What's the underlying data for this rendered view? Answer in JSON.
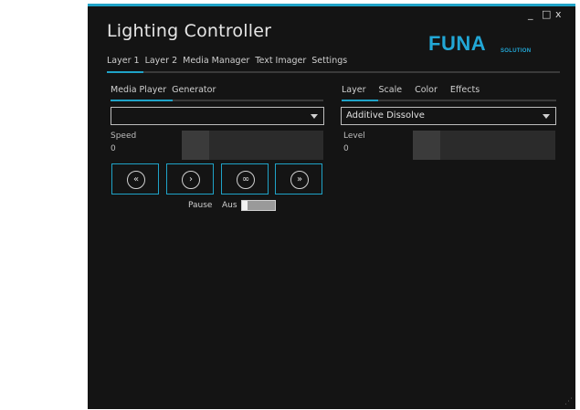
{
  "window": {
    "title": "Lighting Controller",
    "controls": {
      "minimize": "_",
      "maximize": "□",
      "close": "x"
    },
    "logo": {
      "main": "FUNA",
      "sub": "SOLUTION"
    },
    "colors": {
      "accent": "#1fa3c8",
      "background": "#141414"
    }
  },
  "main_tabs": [
    "Layer 1",
    "Layer 2",
    "Media Manager",
    "Text Imager",
    "Settings"
  ],
  "left_panel": {
    "tabs": [
      "Media Player",
      "Generator"
    ],
    "dropdown_value": "",
    "speed": {
      "label": "Speed",
      "value": "0"
    },
    "buttons": [
      {
        "icon": "rewind-icon",
        "glyph": "«"
      },
      {
        "icon": "play-icon",
        "glyph": "›"
      },
      {
        "icon": "loop-icon",
        "glyph": "∞"
      },
      {
        "icon": "fast-forward-icon",
        "glyph": "»"
      }
    ],
    "pause": {
      "label": "Pause",
      "state": "Aus"
    }
  },
  "right_panel": {
    "tabs": [
      "Layer",
      "Scale",
      "Color",
      "Effects"
    ],
    "dropdown_value": "Additive Dissolve",
    "level": {
      "label": "Level",
      "value": "0"
    }
  }
}
